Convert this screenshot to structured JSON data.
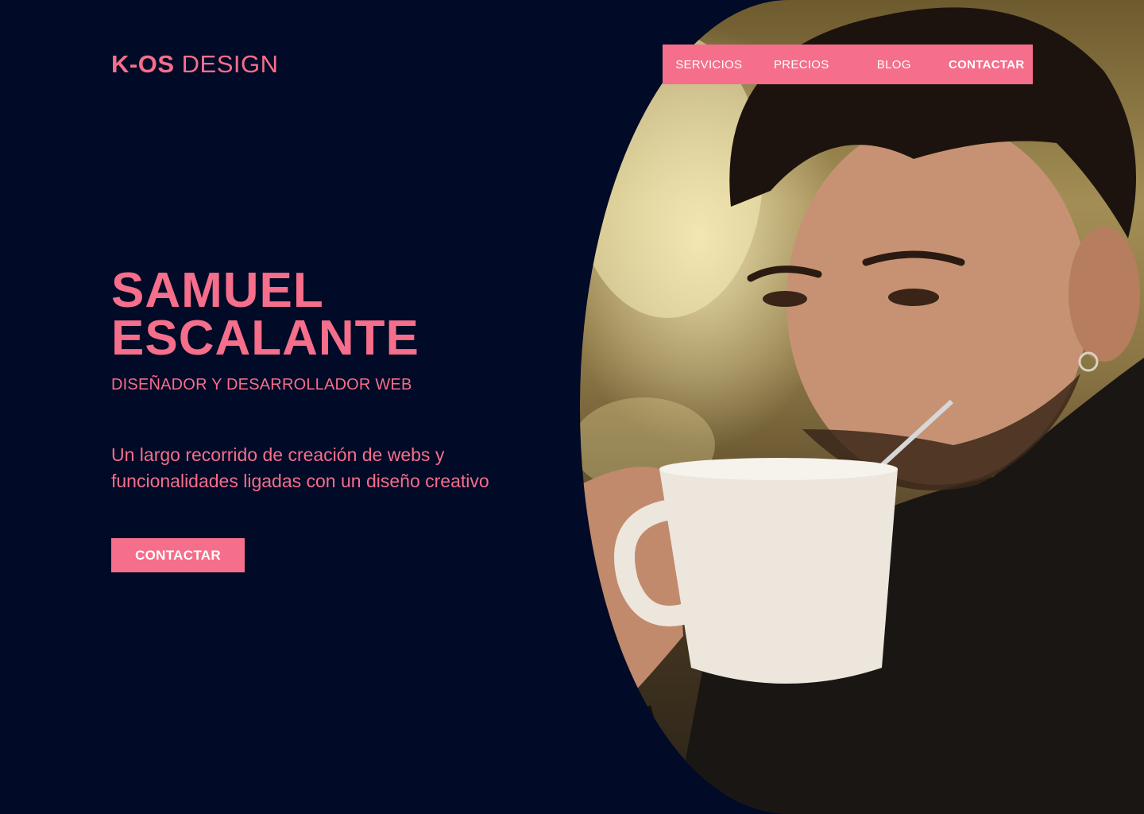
{
  "brand": {
    "logo_bold": "K-OS",
    "logo_light": "DESIGN"
  },
  "nav": {
    "items": [
      {
        "label": "SERVICIOS"
      },
      {
        "label": "PRECIOS"
      },
      {
        "label": "BLOG"
      },
      {
        "label": "CONTACTAR"
      }
    ]
  },
  "hero": {
    "name_line1": "SAMUEL",
    "name_line2": "ESCALANTE",
    "subtitle": "DISEÑADOR Y DESARROLLADOR WEB",
    "description": "Un largo recorrido de creación de webs y funcionalidades ligadas con un diseño creativo",
    "cta_label": "CONTACTAR"
  },
  "colors": {
    "background": "#010a26",
    "accent": "#f56e8b",
    "text_on_accent": "#ffffff"
  }
}
